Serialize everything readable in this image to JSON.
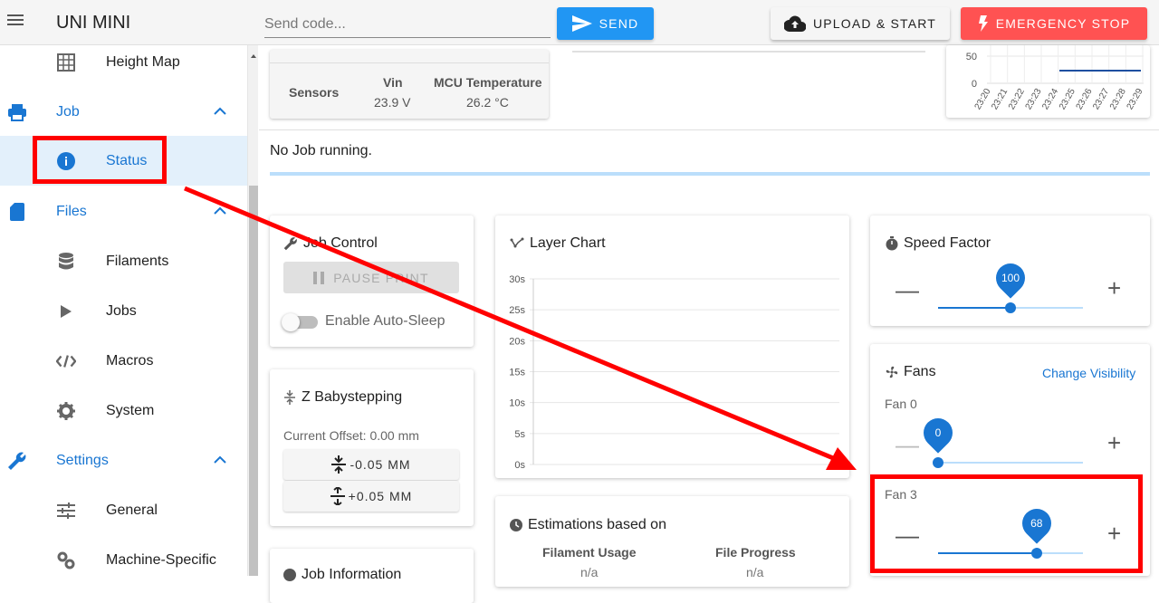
{
  "app": {
    "title": "UNI MINI"
  },
  "topbar": {
    "code_placeholder": "Send code...",
    "send_label": "Send",
    "upload_label": "Upload & Start",
    "estop_label": "Emergency Stop"
  },
  "sidebar": {
    "items": [
      {
        "label": "Height Map",
        "icon": "grid-icon"
      },
      {
        "label": "Job",
        "icon": "printer-icon",
        "group": true
      },
      {
        "label": "Status",
        "icon": "info-icon",
        "active": true
      },
      {
        "label": "Files",
        "icon": "sd-card-icon",
        "group": true
      },
      {
        "label": "Filaments",
        "icon": "database-icon"
      },
      {
        "label": "Jobs",
        "icon": "play-icon"
      },
      {
        "label": "Macros",
        "icon": "code-icon"
      },
      {
        "label": "System",
        "icon": "gear-icon"
      },
      {
        "label": "Settings",
        "icon": "wrench-icon",
        "group": true
      },
      {
        "label": "General",
        "icon": "tune-icon"
      },
      {
        "label": "Machine-Specific",
        "icon": "cogs-icon"
      }
    ]
  },
  "sensors": {
    "label": "Sensors",
    "vin_header": "Vin",
    "vin_value": "23.9 V",
    "mcu_header": "MCU Temperature",
    "mcu_value": "26.2 °C"
  },
  "temp_chart": {
    "y_ticks": [
      "50",
      "0"
    ],
    "x_ticks": [
      "23:20",
      "23:21",
      "23:22",
      "23:23",
      "23:24",
      "23:25",
      "23:26",
      "23:27",
      "23:28",
      "23:29"
    ],
    "line_color": "#1e4fa0"
  },
  "job_status": {
    "text": "No Job running."
  },
  "job_control": {
    "title": "Job Control",
    "pause_label": "Pause Print",
    "autosleep_label": "Enable Auto-Sleep"
  },
  "babystep": {
    "title": "Z Babystepping",
    "offset": "Current Offset: 0.00 mm",
    "minus_label": "-0.05 MM",
    "plus_label": "+0.05 MM"
  },
  "job_info": {
    "title": "Job Information"
  },
  "layer_chart": {
    "title": "Layer Chart",
    "y_ticks": [
      "30s",
      "25s",
      "20s",
      "15s",
      "10s",
      "5s",
      "0s"
    ]
  },
  "estimations": {
    "title": "Estimations based on",
    "col1": "Filament Usage",
    "col2": "File Progress",
    "val1": "n/a",
    "val2": "n/a"
  },
  "speed_factor": {
    "title": "Speed Factor",
    "value": "100",
    "fraction": 0.5
  },
  "fans": {
    "title": "Fans",
    "change_visibility": "Change Visibility",
    "fan0": {
      "label": "Fan 0",
      "value": "0",
      "fraction": 0.0
    },
    "fan3": {
      "label": "Fan 3",
      "value": "68",
      "fraction": 0.68
    }
  },
  "colors": {
    "accent": "#1976d2",
    "send": "#2196f3",
    "estop": "#ff5252",
    "annotation": "#ff0000"
  }
}
